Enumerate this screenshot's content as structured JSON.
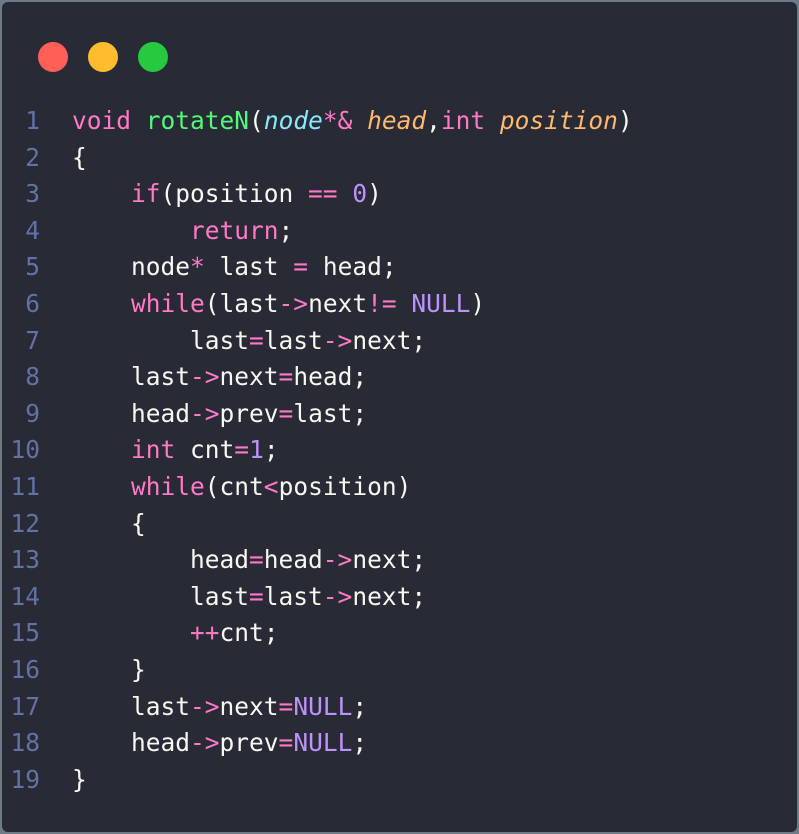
{
  "window": {
    "controls": [
      {
        "name": "close",
        "color": "#ff5f56"
      },
      {
        "name": "minimize",
        "color": "#ffbd2e"
      },
      {
        "name": "maximize",
        "color": "#27c93f"
      }
    ]
  },
  "code": {
    "language": "cpp",
    "lines": [
      [
        {
          "t": "void",
          "c": "kw"
        },
        {
          "t": " ",
          "c": "pl"
        },
        {
          "t": "rotateN",
          "c": "fn"
        },
        {
          "t": "(",
          "c": "pl"
        },
        {
          "t": "node",
          "c": "ty"
        },
        {
          "t": "*&",
          "c": "kw"
        },
        {
          "t": " ",
          "c": "pl"
        },
        {
          "t": "head",
          "c": "par"
        },
        {
          "t": ",",
          "c": "pl"
        },
        {
          "t": "int",
          "c": "kw"
        },
        {
          "t": " ",
          "c": "pl"
        },
        {
          "t": "position",
          "c": "par"
        },
        {
          "t": ")",
          "c": "pl"
        }
      ],
      [
        {
          "t": "{",
          "c": "pl"
        }
      ],
      [
        {
          "t": "    ",
          "c": "pl"
        },
        {
          "t": "if",
          "c": "kw"
        },
        {
          "t": "(position ",
          "c": "pl"
        },
        {
          "t": "==",
          "c": "kw"
        },
        {
          "t": " ",
          "c": "pl"
        },
        {
          "t": "0",
          "c": "num"
        },
        {
          "t": ")",
          "c": "pl"
        }
      ],
      [
        {
          "t": "        ",
          "c": "pl"
        },
        {
          "t": "return",
          "c": "kw"
        },
        {
          "t": ";",
          "c": "pl"
        }
      ],
      [
        {
          "t": "    node",
          "c": "pl"
        },
        {
          "t": "*",
          "c": "kw"
        },
        {
          "t": " last ",
          "c": "pl"
        },
        {
          "t": "=",
          "c": "kw"
        },
        {
          "t": " head;",
          "c": "pl"
        }
      ],
      [
        {
          "t": "    ",
          "c": "pl"
        },
        {
          "t": "while",
          "c": "kw"
        },
        {
          "t": "(last",
          "c": "pl"
        },
        {
          "t": "->",
          "c": "kw"
        },
        {
          "t": "next",
          "c": "pl"
        },
        {
          "t": "!=",
          "c": "kw"
        },
        {
          "t": " ",
          "c": "pl"
        },
        {
          "t": "NULL",
          "c": "num"
        },
        {
          "t": ")",
          "c": "pl"
        }
      ],
      [
        {
          "t": "        last",
          "c": "pl"
        },
        {
          "t": "=",
          "c": "kw"
        },
        {
          "t": "last",
          "c": "pl"
        },
        {
          "t": "->",
          "c": "kw"
        },
        {
          "t": "next;",
          "c": "pl"
        }
      ],
      [
        {
          "t": "    last",
          "c": "pl"
        },
        {
          "t": "->",
          "c": "kw"
        },
        {
          "t": "next",
          "c": "pl"
        },
        {
          "t": "=",
          "c": "kw"
        },
        {
          "t": "head;",
          "c": "pl"
        }
      ],
      [
        {
          "t": "    head",
          "c": "pl"
        },
        {
          "t": "->",
          "c": "kw"
        },
        {
          "t": "prev",
          "c": "pl"
        },
        {
          "t": "=",
          "c": "kw"
        },
        {
          "t": "last;",
          "c": "pl"
        }
      ],
      [
        {
          "t": "    ",
          "c": "pl"
        },
        {
          "t": "int",
          "c": "kw"
        },
        {
          "t": " cnt",
          "c": "pl"
        },
        {
          "t": "=",
          "c": "kw"
        },
        {
          "t": "1",
          "c": "num"
        },
        {
          "t": ";",
          "c": "pl"
        }
      ],
      [
        {
          "t": "    ",
          "c": "pl"
        },
        {
          "t": "while",
          "c": "kw"
        },
        {
          "t": "(cnt",
          "c": "pl"
        },
        {
          "t": "<",
          "c": "kw"
        },
        {
          "t": "position)",
          "c": "pl"
        }
      ],
      [
        {
          "t": "    {",
          "c": "pl"
        }
      ],
      [
        {
          "t": "        head",
          "c": "pl"
        },
        {
          "t": "=",
          "c": "kw"
        },
        {
          "t": "head",
          "c": "pl"
        },
        {
          "t": "->",
          "c": "kw"
        },
        {
          "t": "next;",
          "c": "pl"
        }
      ],
      [
        {
          "t": "        last",
          "c": "pl"
        },
        {
          "t": "=",
          "c": "kw"
        },
        {
          "t": "last",
          "c": "pl"
        },
        {
          "t": "->",
          "c": "kw"
        },
        {
          "t": "next;",
          "c": "pl"
        }
      ],
      [
        {
          "t": "        ",
          "c": "pl"
        },
        {
          "t": "++",
          "c": "kw"
        },
        {
          "t": "cnt;",
          "c": "pl"
        }
      ],
      [
        {
          "t": "    }",
          "c": "pl"
        }
      ],
      [
        {
          "t": "    last",
          "c": "pl"
        },
        {
          "t": "->",
          "c": "kw"
        },
        {
          "t": "next",
          "c": "pl"
        },
        {
          "t": "=",
          "c": "kw"
        },
        {
          "t": "NULL",
          "c": "num"
        },
        {
          "t": ";",
          "c": "pl"
        }
      ],
      [
        {
          "t": "    head",
          "c": "pl"
        },
        {
          "t": "->",
          "c": "kw"
        },
        {
          "t": "prev",
          "c": "pl"
        },
        {
          "t": "=",
          "c": "kw"
        },
        {
          "t": "NULL",
          "c": "num"
        },
        {
          "t": ";",
          "c": "pl"
        }
      ],
      [
        {
          "t": "}",
          "c": "pl"
        }
      ]
    ]
  }
}
